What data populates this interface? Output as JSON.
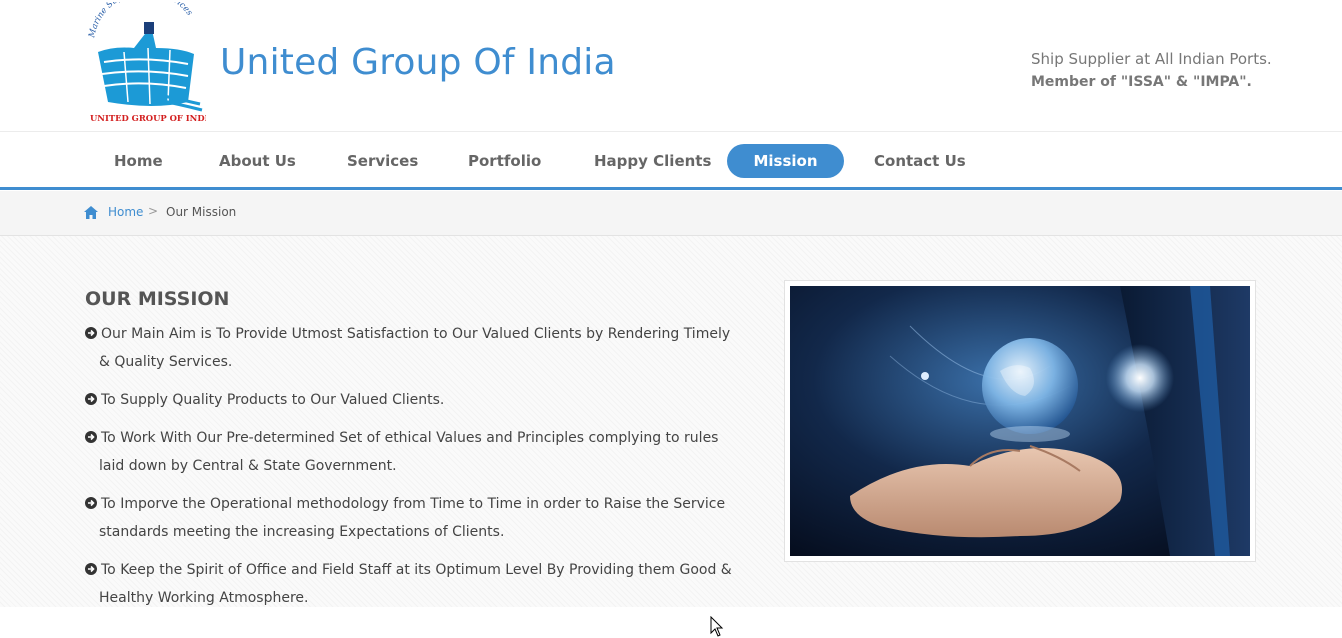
{
  "header": {
    "logo": {
      "arc_text": "Marine Suppliers & Services",
      "caption": "UNITED GROUP OF INDIA"
    },
    "title": "United Group Of India",
    "tagline": "Ship Supplier at All Indian Ports.",
    "membership": "Member of \"ISSA\" & \"IMPA\"."
  },
  "nav": {
    "items": [
      "Home",
      "About Us",
      "Services",
      "Portfolio",
      "Happy Clients",
      "Mission",
      "Contact Us"
    ],
    "active": "Mission"
  },
  "breadcrumb": {
    "home": "Home",
    "separator": ">",
    "current": "Our Mission"
  },
  "mission": {
    "title": "OUR MISSION",
    "items": [
      "Our Main Aim is To Provide Utmost Satisfaction to Our Valued Clients by Rendering Timely & Quality Services.",
      "To Supply Quality Products to Our Valued Clients.",
      "To Work With Our Pre-determined Set of ethical Values and Principles complying to rules laid down by Central & State Government.",
      "To Imporve the Operational methodology from Time to Time in order to Raise the Service standards meeting the increasing Expectations of Clients.",
      "To Keep the Spirit of Office and Field Staff at its Optimum Level By Providing them Good & Healthy Working Atmosphere."
    ]
  },
  "colors": {
    "accent": "#3f8dd0",
    "text": "#444444",
    "muted": "#777777"
  },
  "icons": {
    "home": "home-icon",
    "bullet": "circle-arrow-right-icon",
    "cursor": "mouse-pointer-icon"
  }
}
